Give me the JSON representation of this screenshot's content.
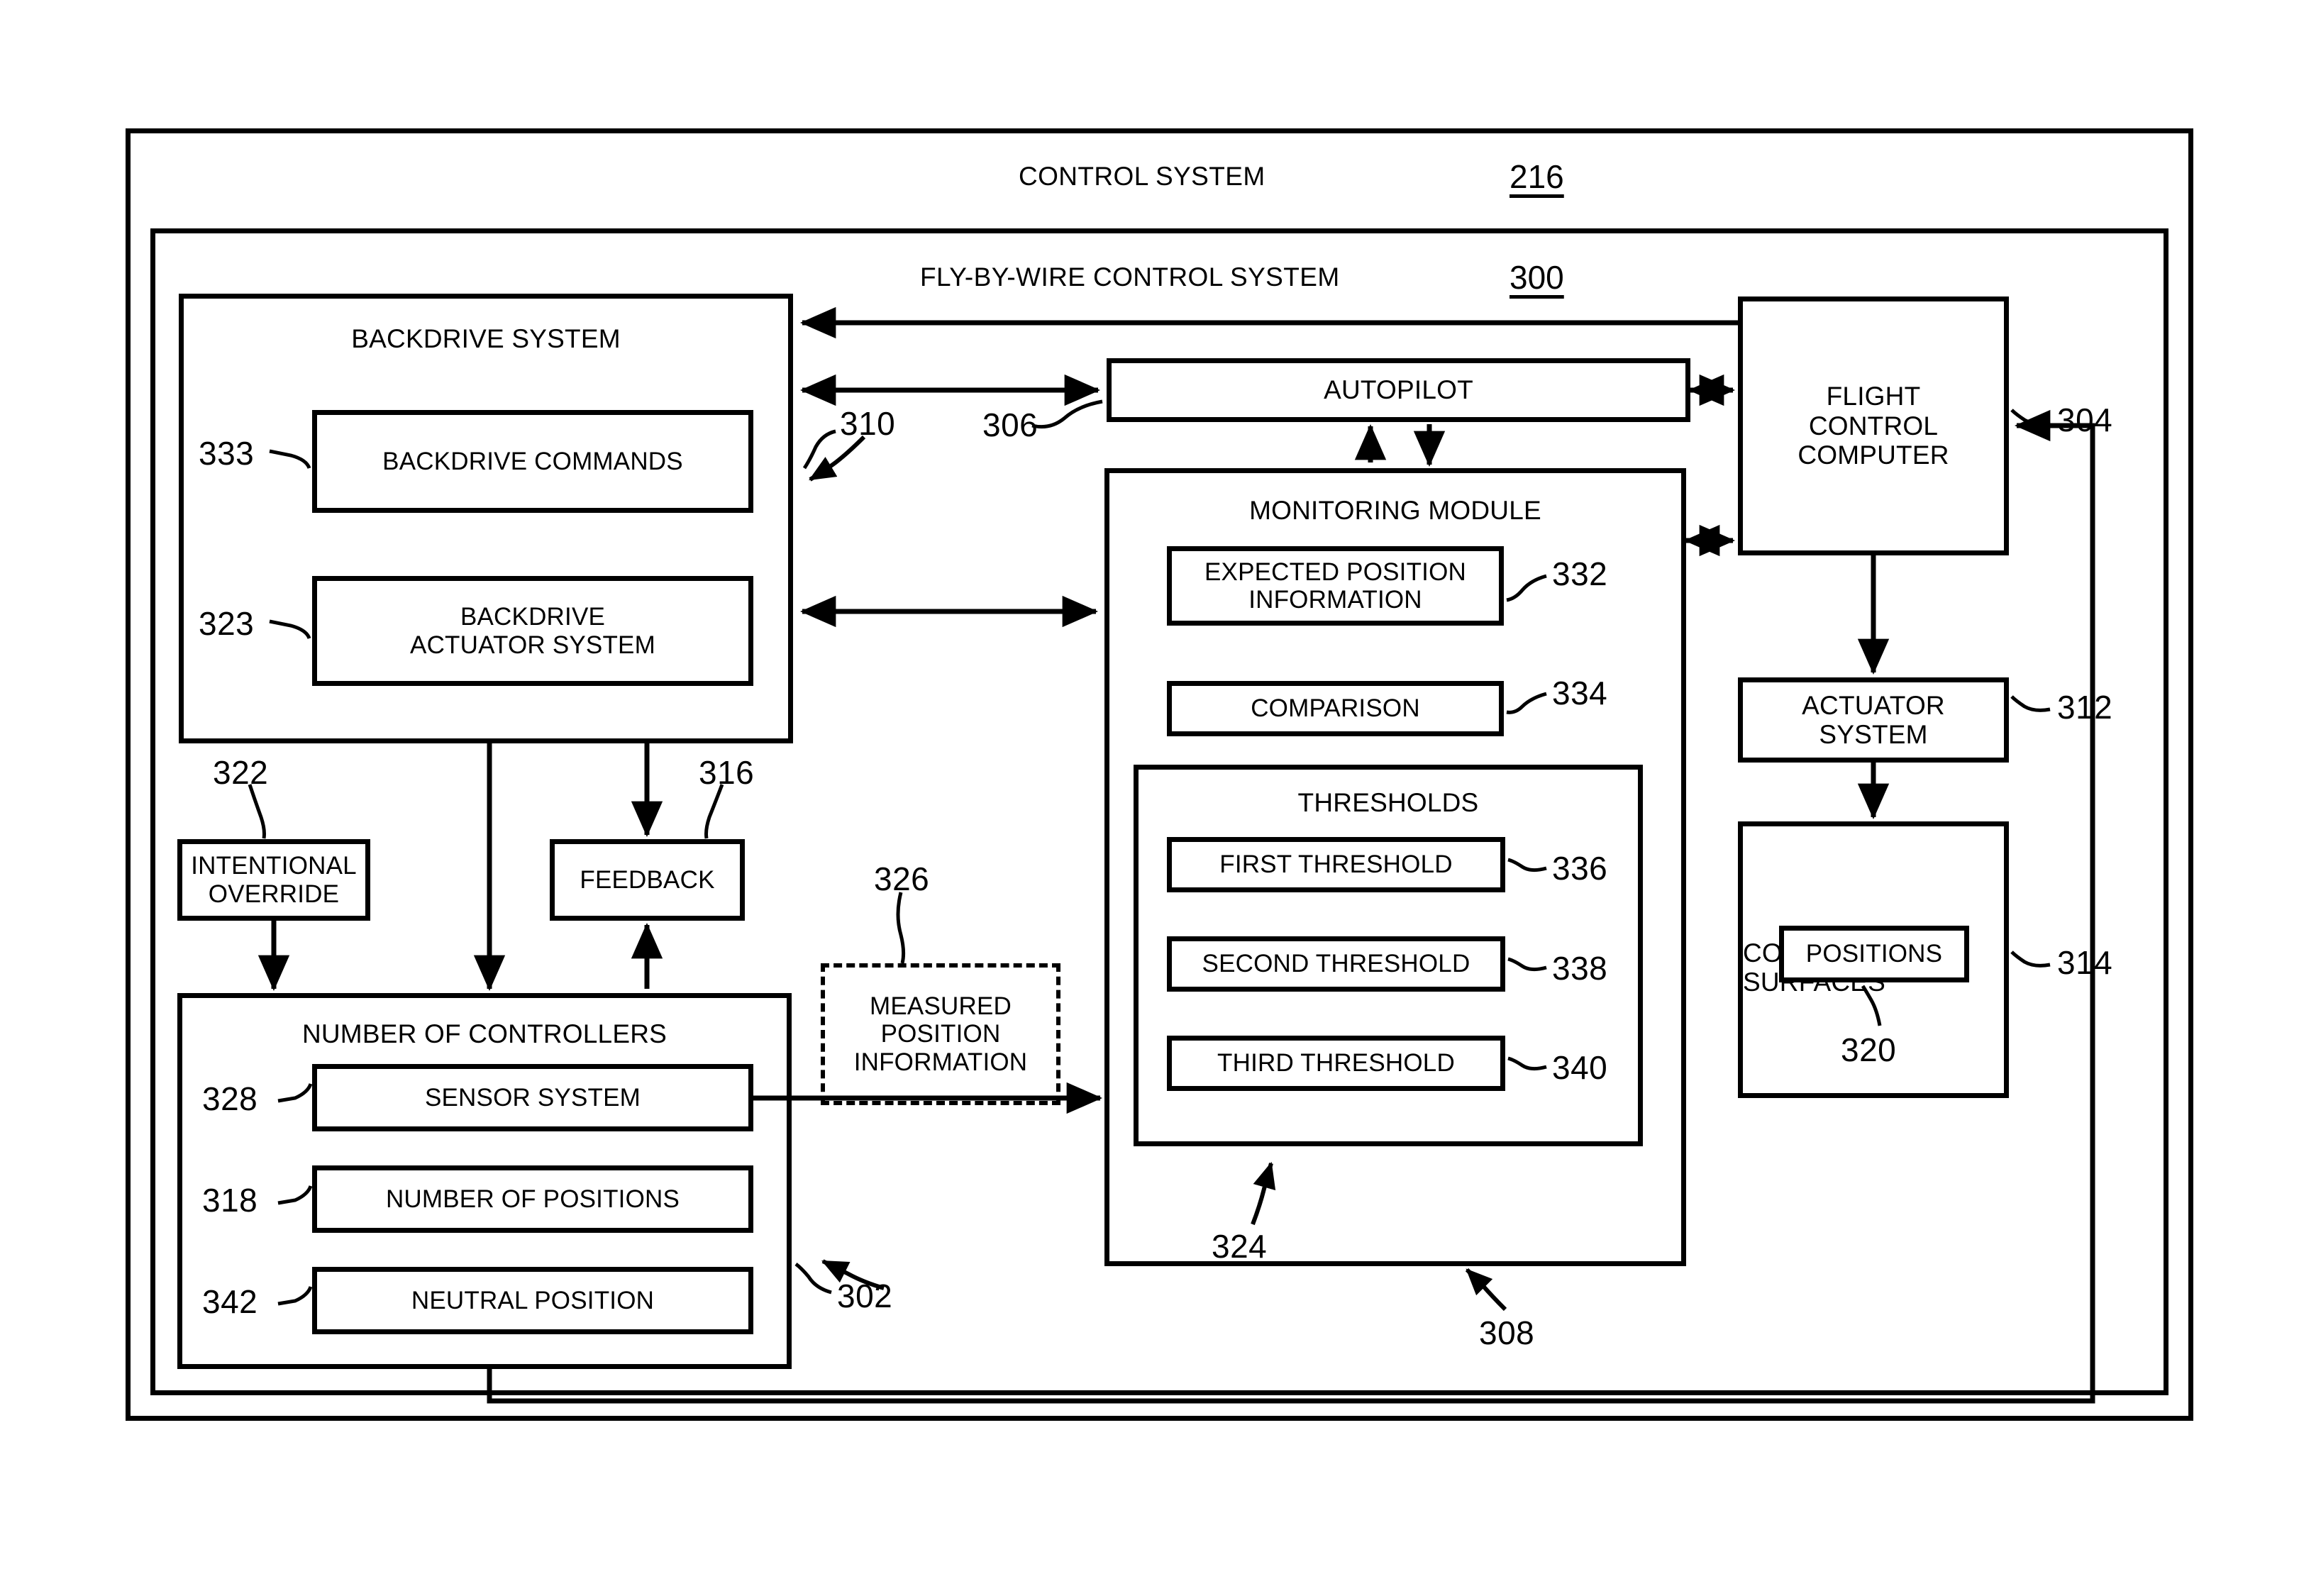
{
  "figure": {
    "outer_title": "CONTROL SYSTEM",
    "outer_ref": "216",
    "inner_title": "FLY-BY-WIRE CONTROL SYSTEM",
    "inner_ref": "300"
  },
  "blocks": {
    "backdrive_system": {
      "label": "BACKDRIVE SYSTEM"
    },
    "backdrive_commands": {
      "label": "BACKDRIVE COMMANDS",
      "ref": "333"
    },
    "backdrive_actuator_system": {
      "label": "BACKDRIVE\nACTUATOR SYSTEM",
      "line1": "BACKDRIVE",
      "line2": "ACTUATOR SYSTEM",
      "ref": "323"
    },
    "intentional_override": {
      "line1": "INTENTIONAL",
      "line2": "OVERRIDE",
      "ref": "322"
    },
    "feedback": {
      "label": "FEEDBACK",
      "ref": "316"
    },
    "measured_position_information": {
      "line1": "MEASURED",
      "line2": "POSITION",
      "line3": "INFORMATION",
      "ref": "326"
    },
    "number_of_controllers": {
      "label": "NUMBER OF CONTROLLERS",
      "ref": "302"
    },
    "sensor_system": {
      "label": "SENSOR SYSTEM",
      "ref": "328"
    },
    "number_of_positions": {
      "label": "NUMBER OF POSITIONS",
      "ref": "318"
    },
    "neutral_position": {
      "label": "NEUTRAL POSITION",
      "ref": "342"
    },
    "autopilot": {
      "label": "AUTOPILOT",
      "ref": "306"
    },
    "monitoring_module": {
      "label": "MONITORING MODULE",
      "ref": "308"
    },
    "expected_position_information": {
      "line1": "EXPECTED POSITION",
      "line2": "INFORMATION",
      "ref": "332"
    },
    "comparison": {
      "label": "COMPARISON",
      "ref": "334"
    },
    "thresholds": {
      "label": "THRESHOLDS",
      "ref": "324"
    },
    "first_threshold": {
      "label": "FIRST THRESHOLD",
      "ref": "336"
    },
    "second_threshold": {
      "label": "SECOND THRESHOLD",
      "ref": "338"
    },
    "third_threshold": {
      "label": "THIRD THRESHOLD",
      "ref": "340"
    },
    "flight_control_computer": {
      "line1": "FLIGHT",
      "line2": "CONTROL",
      "line3": "COMPUTER",
      "ref": "304"
    },
    "actuator_system": {
      "line1": "ACTUATOR",
      "line2": "SYSTEM",
      "ref": "312"
    },
    "control_surfaces": {
      "line1": "CONTROL",
      "line2": "SURFACES",
      "ref": "314"
    },
    "positions": {
      "label": "POSITIONS",
      "ref": "320"
    }
  },
  "connectors": {
    "backdrive_to_flight_control_ref": "310"
  },
  "colors": {
    "stroke": "#000000",
    "background": "#ffffff"
  }
}
